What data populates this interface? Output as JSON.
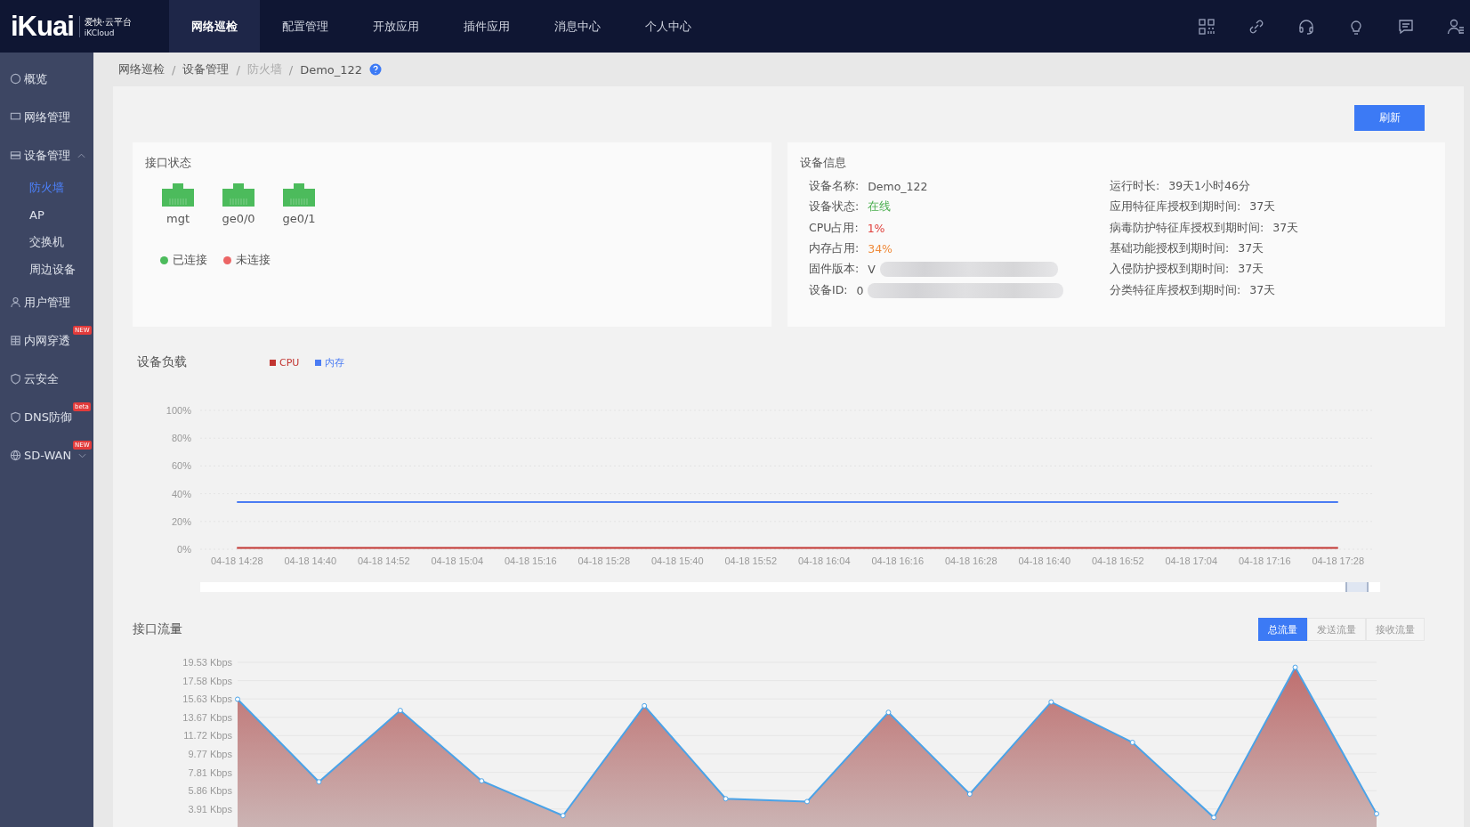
{
  "logo": {
    "brand": "iKuai",
    "product": "爱快·云平台",
    "sub": "iKCloud"
  },
  "top_nav": [
    {
      "label": "网络巡检",
      "selected": true
    },
    {
      "label": "配置管理",
      "selected": false
    },
    {
      "label": "开放应用",
      "selected": false
    },
    {
      "label": "插件应用",
      "selected": false
    },
    {
      "label": "消息中心",
      "selected": false
    },
    {
      "label": "个人中心",
      "selected": false
    }
  ],
  "sidebar": {
    "items": [
      {
        "label": "概览",
        "selected": false
      },
      {
        "label": "网络管理",
        "selected": false
      },
      {
        "label": "设备管理",
        "selected": false,
        "expanded": true,
        "children": [
          {
            "label": "防火墙",
            "selected": true
          },
          {
            "label": "AP",
            "selected": false
          },
          {
            "label": "交换机",
            "selected": false
          },
          {
            "label": "周边设备",
            "selected": false
          }
        ]
      },
      {
        "label": "用户管理",
        "selected": false
      },
      {
        "label": "内网穿透",
        "selected": false,
        "badge": "NEW"
      },
      {
        "label": "云安全",
        "selected": false
      },
      {
        "label": "DNS防御",
        "selected": false,
        "badge": "beta"
      },
      {
        "label": "SD-WAN",
        "selected": false,
        "badge": "NEW",
        "expanded": false
      }
    ]
  },
  "breadcrumb": [
    {
      "label": "网络巡检",
      "disabled": false
    },
    {
      "separator": "/"
    },
    {
      "label": "设备管理",
      "disabled": false
    },
    {
      "separator": "/"
    },
    {
      "label": "防火墙",
      "disabled": true
    },
    {
      "separator": "/"
    },
    {
      "label": "Demo_122",
      "disabled": false
    }
  ],
  "refresh_button": "刷新",
  "interface_status": {
    "title": "接口状态",
    "ports": [
      {
        "name": "mgt",
        "connected": true
      },
      {
        "name": "ge0/0",
        "connected": true
      },
      {
        "name": "ge0/1",
        "connected": true
      }
    ],
    "legend": [
      {
        "label": "已连接",
        "color": "#4cbb5c"
      },
      {
        "label": "未连接",
        "color": "#ec6565"
      }
    ]
  },
  "device_info": {
    "title": "设备信息",
    "left": [
      {
        "label": "设备名称:",
        "value": "Demo_122"
      },
      {
        "label": "设备状态:",
        "value": "在线",
        "color": "#4caf50"
      },
      {
        "label": "CPU占用:",
        "value": "1%",
        "color": "#e0403c"
      },
      {
        "label": "内存占用:",
        "value": "34%",
        "color": "#ef8a3a"
      },
      {
        "label": "固件版本:",
        "value": "V",
        "redacted": true
      },
      {
        "label": "设备ID:",
        "value": "0",
        "redacted": true
      }
    ],
    "right": [
      {
        "label": "运行时长:",
        "value": "39天1小时46分"
      },
      {
        "label": "应用特征库授权到期时间:",
        "value": "37天"
      },
      {
        "label": "病毒防护特征库授权到期时间:",
        "value": "37天"
      },
      {
        "label": "基础功能授权到期时间:",
        "value": "37天"
      },
      {
        "label": "入侵防护授权到期时间:",
        "value": "37天"
      },
      {
        "label": "分类特征库授权到期时间:",
        "value": "37天"
      }
    ]
  },
  "device_load": {
    "title": "设备负载",
    "zoom_slider": {
      "level": 0.99
    },
    "chart_data": {
      "type": "line",
      "categories": [
        "04-18 14:28",
        "04-18 14:40",
        "04-18 14:52",
        "04-18 15:04",
        "04-18 15:16",
        "04-18 15:28",
        "04-18 15:40",
        "04-18 15:52",
        "04-18 16:04",
        "04-18 16:16",
        "04-18 16:28",
        "04-18 16:40",
        "04-18 16:52",
        "04-18 17:04",
        "04-18 17:16",
        "04-18 17:28"
      ],
      "series": [
        {
          "name": "CPU",
          "color": "#c23531",
          "values": [
            1,
            1,
            1,
            1,
            1,
            1,
            1,
            1,
            1,
            1,
            1,
            1,
            1,
            1,
            1,
            1
          ]
        },
        {
          "name": "内存",
          "color": "#4b7cf3",
          "values": [
            34,
            34,
            34,
            34,
            34,
            34,
            34,
            34,
            34,
            34,
            34,
            34,
            34,
            34,
            34,
            34
          ]
        }
      ],
      "ylim": [
        0,
        100
      ],
      "grid": true,
      "yticks": [
        {
          "value": 0,
          "label": "0%"
        },
        {
          "value": 20,
          "label": "20%"
        },
        {
          "value": 40,
          "label": "40%"
        },
        {
          "value": 60,
          "label": "60%"
        },
        {
          "value": 80,
          "label": "80%"
        },
        {
          "value": 100,
          "label": "100%"
        }
      ]
    }
  },
  "interface_traffic": {
    "title": "接口流量",
    "tabs": [
      {
        "label": "总流量",
        "selected": true
      },
      {
        "label": "发送流量",
        "selected": false
      },
      {
        "label": "接收流量",
        "selected": false
      }
    ],
    "chart_data": {
      "type": "area",
      "series": [
        {
          "color": "#4aa3e8",
          "values": [
            15.6,
            6.8,
            14.4,
            6.9,
            3.2,
            14.9,
            5.0,
            4.7,
            14.2,
            5.5,
            15.3,
            11.0,
            3.0,
            19.0,
            3.4
          ]
        }
      ],
      "ylim": [
        0,
        19.53
      ],
      "grid": true,
      "yticks": [
        {
          "value": 3.91,
          "label": "3.91 Kbps"
        },
        {
          "value": 5.86,
          "label": "5.86 Kbps"
        },
        {
          "value": 7.81,
          "label": "7.81 Kbps"
        },
        {
          "value": 9.77,
          "label": "9.77 Kbps"
        },
        {
          "value": 11.72,
          "label": "11.72 Kbps"
        },
        {
          "value": 13.67,
          "label": "13.67 Kbps"
        },
        {
          "value": 15.63,
          "label": "15.63 Kbps"
        },
        {
          "value": 17.58,
          "label": "17.58 Kbps"
        },
        {
          "value": 19.53,
          "label": "19.53 Kbps"
        }
      ]
    }
  }
}
